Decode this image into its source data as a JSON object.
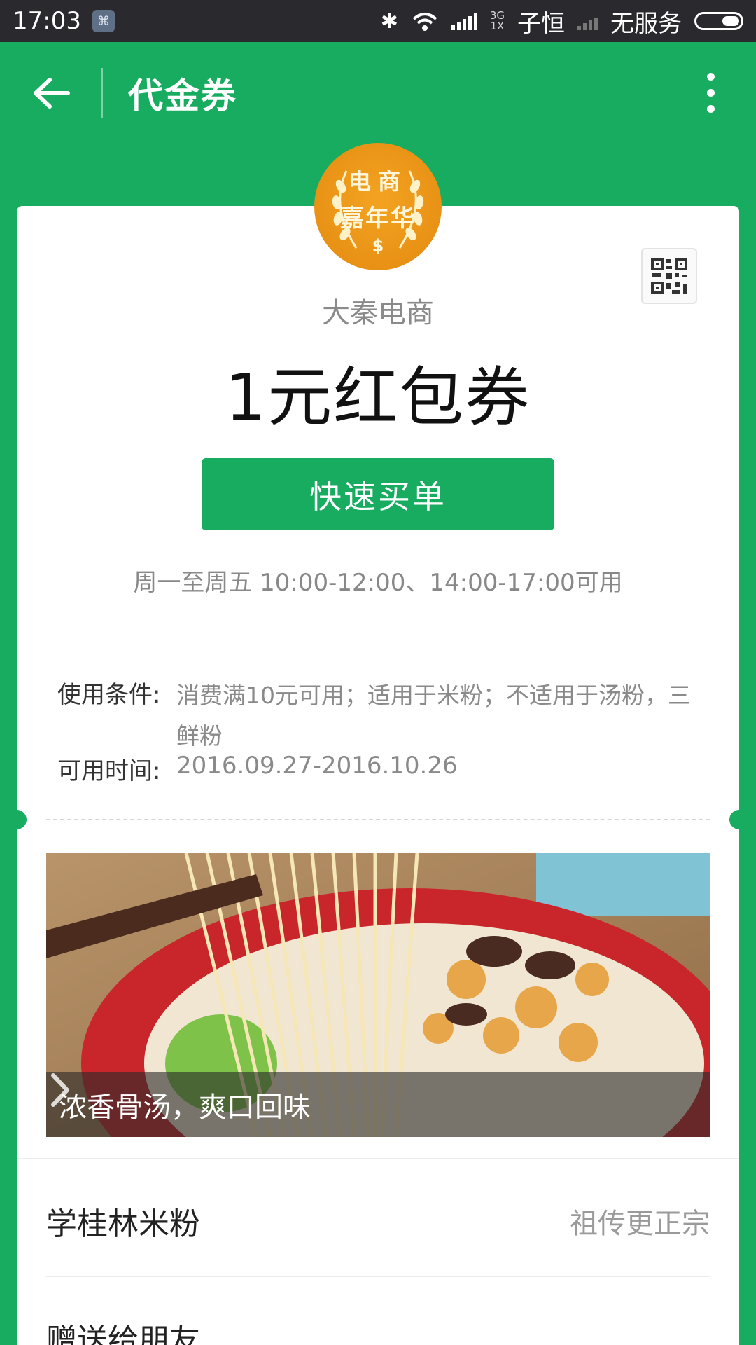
{
  "status_bar": {
    "time": "17:03",
    "network_type_top": "3G",
    "network_type_bottom": "1X",
    "carrier": "子恒",
    "no_service": "无服务"
  },
  "app_bar": {
    "title": "代金券"
  },
  "coupon": {
    "logo": {
      "line1": "电商",
      "line2": "嘉年华",
      "line3": "$"
    },
    "merchant": "大秦电商",
    "title": "1元红包券",
    "action_label": "快速买单",
    "hours": "周一至周五 10:00-12:00、14:00-17:00可用",
    "conditions_label": "使用条件:",
    "conditions_value": "消费满10元可用；适用于米粉；不适用于汤粉，三鲜粉",
    "validity_label": "可用时间:",
    "validity_value": "2016.09.27-2016.10.26"
  },
  "banner": {
    "caption": "浓香骨汤，爽口回味"
  },
  "rows": [
    {
      "label": "学桂林米粉",
      "value": "祖传更正宗"
    },
    {
      "label": "赠送给朋友"
    }
  ],
  "colors": {
    "brand_green": "#17ac5f",
    "logo_orange": "#e8900f",
    "status_bar": "#2a2a2e"
  },
  "icons": {
    "back": "arrow-left-icon",
    "menu": "more-vertical-icon",
    "qr": "qr-code-icon",
    "chevron": "chevron-right-icon"
  }
}
